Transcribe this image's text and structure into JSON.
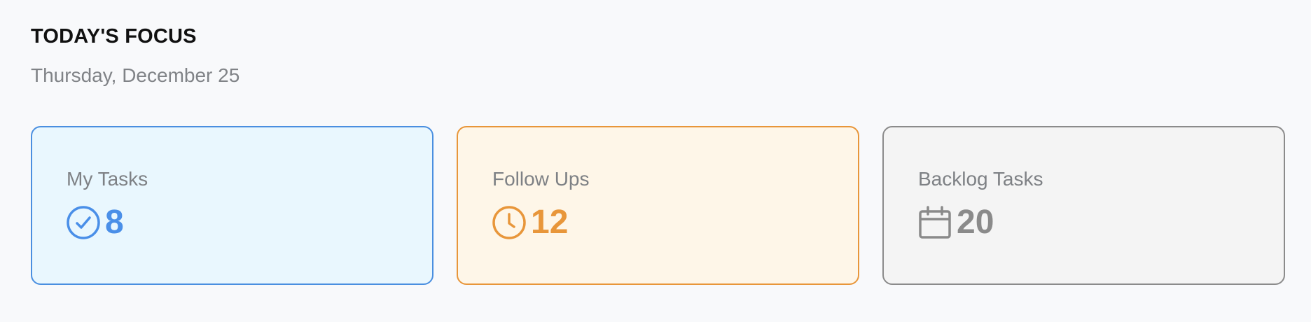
{
  "header": {
    "title": "TODAY'S FOCUS",
    "date": "Thursday, December 25"
  },
  "cards": [
    {
      "label": "My Tasks",
      "count": "8",
      "icon": "check-circle-icon",
      "color": "#4a8fe8"
    },
    {
      "label": "Follow Ups",
      "count": "12",
      "icon": "clock-icon",
      "color": "#e8963a"
    },
    {
      "label": "Backlog Tasks",
      "count": "20",
      "icon": "calendar-icon",
      "color": "#8a8a8a"
    }
  ]
}
